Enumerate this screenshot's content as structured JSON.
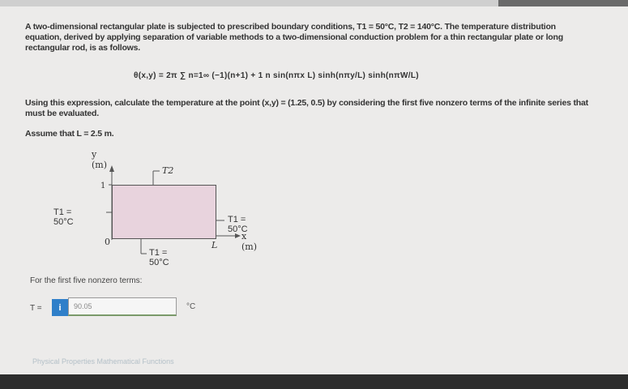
{
  "problem": {
    "intro": "A two-dimensional rectangular plate is subjected to prescribed boundary conditions, T1 = 50°C, T2 = 140°C. The temperature distribution equation, derived by applying separation of variable methods to a two-dimensional conduction problem for a thin rectangular plate or long rectangular rod, is as follows.",
    "equation": "θ(x,y) = 2π ∑ n=1∞ (−1)(n+1) + 1 n sin(nπx L) sinh(nπy/L) sinh(nπW/L)",
    "instruction": "Using this expression, calculate the temperature at the point (x,y) = (1.25, 0.5) by considering the first five nonzero terms of the infinite series that must be evaluated.",
    "assumption": "Assume that L = 2.5 m."
  },
  "diagram": {
    "y_axis_label": "y (m)",
    "y_tick": "1",
    "top_label": "T2",
    "left_label": "T1 = 50°C",
    "right_label": "T1 = 50°C",
    "x_axis_label": "x (m)",
    "origin": "0",
    "bottom_label": "T1 = 50°C",
    "length_label": "L"
  },
  "answer": {
    "prompt": "For the first five nonzero terms:",
    "variable": "T =",
    "info_button": "i",
    "value": "90.05",
    "unit": "°C"
  },
  "footer": {
    "links": "Physical Properties  Mathematical Functions"
  }
}
